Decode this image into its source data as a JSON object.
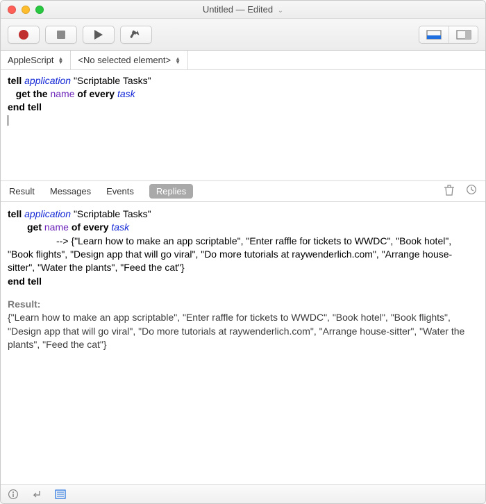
{
  "window": {
    "title": "Untitled — Edited"
  },
  "toolbar": {
    "record": "record",
    "stop": "stop",
    "run": "run",
    "compile": "compile"
  },
  "selectors": {
    "language": "AppleScript",
    "element": "<No selected element>"
  },
  "script": {
    "line1_tell": "tell",
    "line1_application": "application",
    "line1_target": "\"Scriptable Tasks\"",
    "line2_get": "get the",
    "line2_name": "name",
    "line2_of_every": "of every",
    "line2_task": "task",
    "line3": "end tell"
  },
  "tabs": {
    "result": "Result",
    "messages": "Messages",
    "events": "Events",
    "replies": "Replies"
  },
  "log": {
    "l1_tell": "tell",
    "l1_application": "application",
    "l1_target": "\"Scriptable Tasks\"",
    "l2_get": "get",
    "l2_name": "name",
    "l2_of_every": "of every",
    "l2_task": "task",
    "arrow": "-->",
    "reply_values": "{\"Learn how to make an app scriptable\", \"Enter raffle for tickets to WWDC\", \"Book hotel\", \"Book flights\", \"Design app that will go viral\", \"Do more tutorials at raywenderlich.com\", \"Arrange house-sitter\", \"Water the plants\", \"Feed the cat\"}",
    "end": "end tell",
    "result_label": "Result:",
    "result_body": "{\"Learn how to make an app scriptable\", \"Enter raffle for tickets to WWDC\", \"Book hotel\", \"Book flights\", \"Design app that will go viral\", \"Do more tutorials at raywenderlich.com\", \"Arrange house-sitter\", \"Water the plants\", \"Feed the cat\"}"
  }
}
